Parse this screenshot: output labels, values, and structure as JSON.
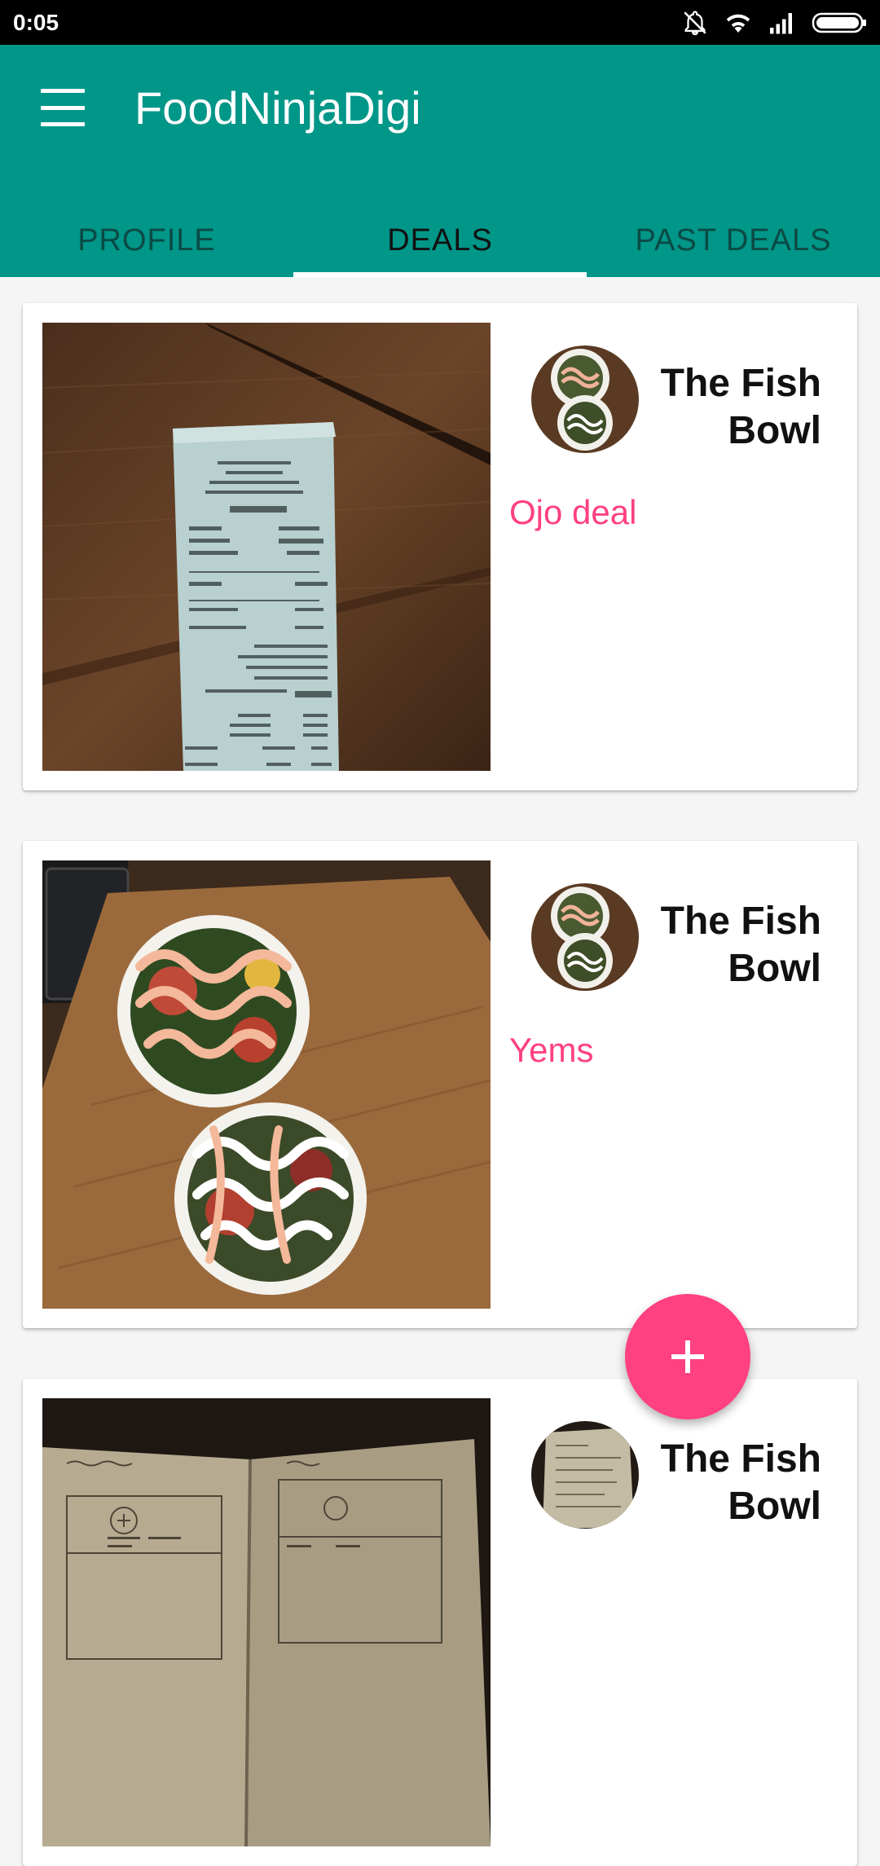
{
  "status_bar": {
    "time": "0:05",
    "icons": [
      "bell-off-icon",
      "wifi-icon",
      "signal-icon",
      "battery-icon"
    ]
  },
  "app_bar": {
    "title": "FoodNinjaDigi",
    "menu_icon": "hamburger-menu-icon",
    "color": "#009688"
  },
  "tabs": [
    {
      "label": "PROFILE",
      "active": false
    },
    {
      "label": "DEALS",
      "active": true
    },
    {
      "label": "PAST DEALS",
      "active": false
    }
  ],
  "deals": [
    {
      "restaurant": "The Fish Bowl",
      "deal_title": "Ojo deal",
      "photo": "receipt-photo"
    },
    {
      "restaurant": "The Fish Bowl",
      "deal_title": "Yems",
      "photo": "poke-bowls-photo"
    },
    {
      "restaurant": "The Fish Bowl",
      "deal_title": "",
      "photo": "sketch-notebook-photo"
    }
  ],
  "fab": {
    "icon": "plus-icon",
    "color": "#ff4081"
  },
  "accent_color": "#ff4081"
}
